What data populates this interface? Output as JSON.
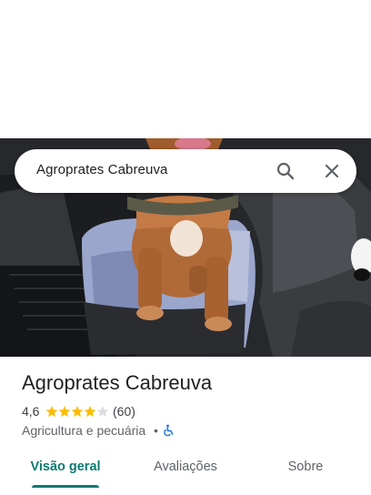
{
  "search": {
    "query": "Agroprates Cabreuva",
    "search_icon": "search-icon",
    "close_icon": "close-icon"
  },
  "place": {
    "title": "Agroprates Cabreuva",
    "rating": "4,6",
    "stars": 4.6,
    "reviews": "(60)",
    "category": "Agricultura e pecuária",
    "separator": "•",
    "accessibility_icon": "wheelchair-icon"
  },
  "tabs": [
    {
      "label": "Visão geral",
      "active": true
    },
    {
      "label": "Avaliações",
      "active": false
    },
    {
      "label": "Sobre",
      "active": false
    }
  ],
  "colors": {
    "accent": "#0b7a70",
    "star": "#fbbc04",
    "accessibility": "#1a73e8"
  }
}
